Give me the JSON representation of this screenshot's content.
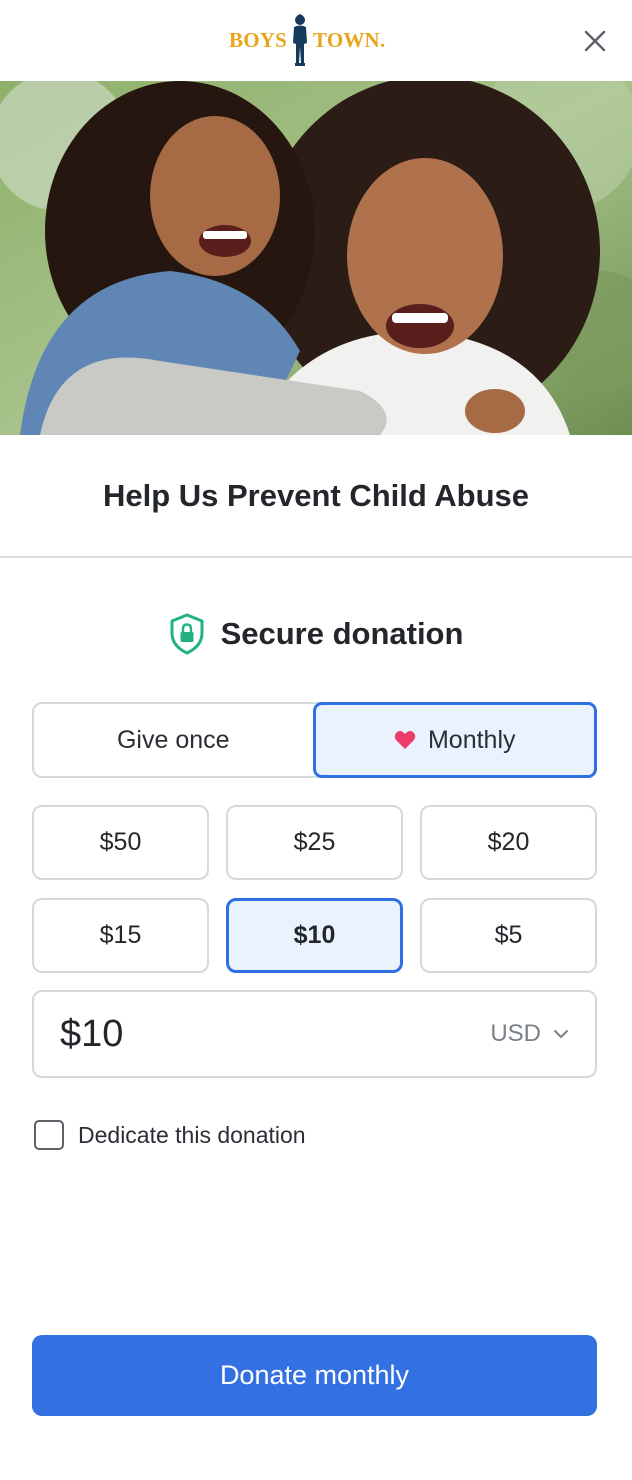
{
  "header": {
    "logo_left": "BOYS",
    "logo_right": "TOWN."
  },
  "title": "Help Us Prevent Child Abuse",
  "secure": {
    "label": "Secure donation"
  },
  "frequency": {
    "options": [
      {
        "label": "Give once",
        "selected": false
      },
      {
        "label": "Monthly",
        "selected": true
      }
    ]
  },
  "amounts": [
    {
      "label": "$50",
      "selected": false
    },
    {
      "label": "$25",
      "selected": false
    },
    {
      "label": "$20",
      "selected": false
    },
    {
      "label": "$15",
      "selected": false
    },
    {
      "label": "$10",
      "selected": true
    },
    {
      "label": "$5",
      "selected": false
    }
  ],
  "amount_input": {
    "value": "$10",
    "currency": "USD"
  },
  "dedicate": {
    "label": "Dedicate this donation",
    "checked": false
  },
  "submit": {
    "label": "Donate monthly"
  },
  "colors": {
    "accent": "#3371e3",
    "selected_bg": "#eaf2fe",
    "logo": "#e8a51a",
    "heart": "#ec3c6a",
    "shield": "#21b27f"
  }
}
